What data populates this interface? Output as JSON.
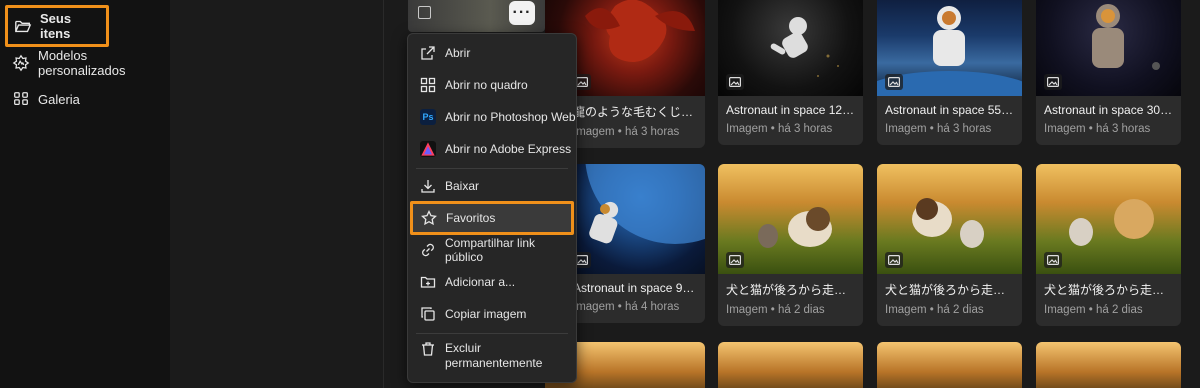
{
  "sidebar": {
    "items": [
      {
        "label": "Seus itens",
        "icon": "folder-open-icon",
        "active": true
      },
      {
        "label": "Modelos personalizados",
        "icon": "custom-models-icon"
      },
      {
        "label": "Galeria",
        "icon": "gallery-icon"
      }
    ]
  },
  "context_menu": {
    "items": [
      {
        "label": "Abrir",
        "icon": "open-icon"
      },
      {
        "label": "Abrir no quadro",
        "icon": "board-icon"
      },
      {
        "label": "Abrir no Photoshop Web",
        "icon": "photoshop-icon"
      },
      {
        "label": "Abrir no Adobe Express",
        "icon": "adobe-express-icon"
      },
      {
        "label": "Baixar",
        "icon": "download-icon"
      },
      {
        "label": "Favoritos",
        "icon": "star-icon",
        "highlighted": true
      },
      {
        "label": "Compartilhar link público",
        "icon": "link-icon"
      },
      {
        "label": "Adicionar a...",
        "icon": "add-to-folder-icon"
      },
      {
        "label": "Copiar imagem",
        "icon": "copy-icon"
      },
      {
        "label": "Excluir permanentemente",
        "line1": "Excluir",
        "line2": "permanentemente",
        "icon": "trash-icon"
      }
    ],
    "ps_badge": "Ps"
  },
  "more_button_label": "···",
  "cards": [
    {
      "title": "龍のような毛むくじゃ...",
      "meta": "Imagem • há 3 horas"
    },
    {
      "title": "Astronaut in space 12241...",
      "meta": "Imagem • há 3 horas"
    },
    {
      "title": "Astronaut in space 55377...",
      "meta": "Imagem • há 3 horas"
    },
    {
      "title": "Astronaut in space 3027...",
      "meta": "Imagem • há 3 horas"
    },
    {
      "title": "Astronaut in space 9052...",
      "meta": "Imagem • há 4 horas"
    },
    {
      "title": "犬と猫が後ろから走っ...",
      "meta": "Imagem • há 2 dias"
    },
    {
      "title": "犬と猫が後ろから走っ...",
      "meta": "Imagem • há 2 dias"
    },
    {
      "title": "犬と猫が後ろから走っ...",
      "meta": "Imagem • há 2 dias"
    }
  ],
  "colors": {
    "highlight": "#f0901a",
    "background": "#1b1b1b",
    "sidebar": "#121212"
  }
}
